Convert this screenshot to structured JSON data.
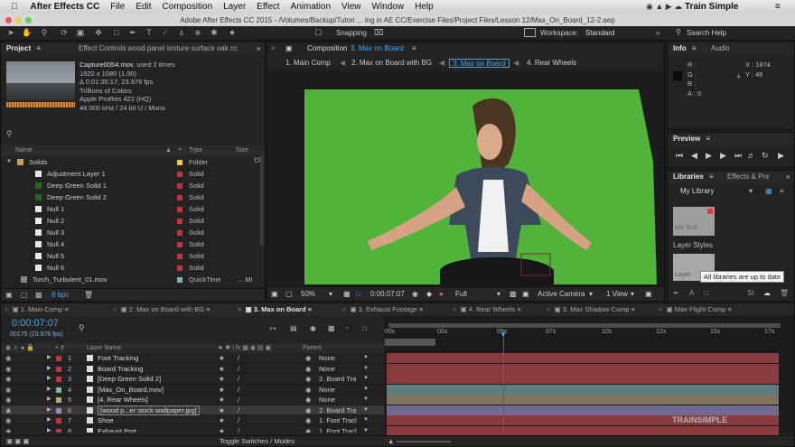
{
  "menubar": {
    "app": "After Effects CC",
    "items": [
      "File",
      "Edit",
      "Composition",
      "Layer",
      "Effect",
      "Animation",
      "View",
      "Window",
      "Help"
    ],
    "brand": "Train Simple"
  },
  "window_title": "Adobe After Effects CC 2015 - /Volumes/Backup/Tutori ... ing in AE CC/Exercise Files/Project Files/Lesson 12/Max_On_Board_12-2.aep",
  "toolbar": {
    "snapping": "Snapping",
    "workspace_label": "Workspace:",
    "workspace": "Standard",
    "search": "Search Help"
  },
  "project": {
    "tab": "Project",
    "effect_tab": "Effect Controls wood panel texture surface oak cc",
    "file_name": "Capture0054.mov",
    "used": ", used 2 times",
    "meta": [
      "1920 x 1080 (1.00)",
      "Δ 0:01:35:17, 23.976 fps",
      "Trillions of Colors",
      "Apple ProRes 422 (HQ)",
      "48.000 kHz / 24 bit U / Mono"
    ],
    "columns": {
      "name": "Name",
      "type": "Type",
      "size": "Size"
    },
    "items": [
      {
        "name": "Solids",
        "type": "Folder",
        "color": "#e6c84a",
        "icon": "folder-icon",
        "indent": 1
      },
      {
        "name": "Adjustment Layer 1",
        "type": "Solid",
        "color": "#c0363a",
        "icon": "white-solid-icon",
        "indent": 2
      },
      {
        "name": "Deep Green Solid 1",
        "type": "Solid",
        "color": "#c0363a",
        "icon": "green-solid-icon",
        "indent": 2
      },
      {
        "name": "Deep Green Solid 2",
        "type": "Solid",
        "color": "#c0363a",
        "icon": "green-solid-icon",
        "indent": 2
      },
      {
        "name": "Null 1",
        "type": "Solid",
        "color": "#c0363a",
        "icon": "white-solid-icon",
        "indent": 2
      },
      {
        "name": "Null 2",
        "type": "Solid",
        "color": "#c0363a",
        "icon": "white-solid-icon",
        "indent": 2
      },
      {
        "name": "Null 3",
        "type": "Solid",
        "color": "#c0363a",
        "icon": "white-solid-icon",
        "indent": 2
      },
      {
        "name": "Null 4",
        "type": "Solid",
        "color": "#c0363a",
        "icon": "white-solid-icon",
        "indent": 2
      },
      {
        "name": "Null 5",
        "type": "Solid",
        "color": "#c0363a",
        "icon": "white-solid-icon",
        "indent": 2
      },
      {
        "name": "Null 6",
        "type": "Solid",
        "color": "#c0363a",
        "icon": "white-solid-icon",
        "indent": 2
      },
      {
        "name": "Torch_Turbulent_01.mov",
        "type": "QuickTime",
        "size": "... MI",
        "color": "#7fb4b4",
        "icon": "footage-icon",
        "indent": 0
      }
    ],
    "bpc": "8 bpc"
  },
  "composition": {
    "tab_prefix": "Composition",
    "tab": "3. Max on Board",
    "breadcrumbs": [
      "1. Main Comp",
      "2. Max on Board with BG",
      "3. Max on Board",
      "4. Rear Wheels"
    ],
    "zoom": "50%",
    "timecode": "0:00:07:07",
    "resolution": "Full",
    "camera": "Active Camera",
    "view": "1 View"
  },
  "info": {
    "tab": "Info",
    "audio_tab": "Audio",
    "r": "R :",
    "g": "G :",
    "b": "B :",
    "a": "A : 0",
    "x": "X : 1874",
    "y": "Y : 46"
  },
  "preview": {
    "tab": "Preview"
  },
  "libraries": {
    "tab": "Libraries",
    "effects_tab": "Effects & Pre",
    "library": "My Library",
    "item1": "MV Bolt",
    "section": "Layer Styles",
    "item2": "Layer",
    "tooltip": "All libraries are up to date"
  },
  "timeline": {
    "tabs": [
      "1. Main Comp",
      "2. Max on Board with BG",
      "3. Max on Board",
      "3. Exhaust Footage",
      "4. Rear Wheels",
      "3. Max Shadow Comp",
      "Max Flight Comp"
    ],
    "active_tab": 2,
    "timecode": "0:00:07:07",
    "frames": "00175 (23.976 fps)",
    "col_layer": "Layer Name",
    "col_parent": "Parent",
    "ruler": [
      "00s",
      "05s",
      "10s",
      "15s",
      "17s"
    ],
    "ruler_mid": [
      "02s",
      "07s",
      "12s"
    ],
    "layers": [
      {
        "num": "1",
        "name": "Foot Tracking",
        "label": "#c0363a",
        "parent": "None",
        "bar": "#8a3b3d"
      },
      {
        "num": "2",
        "name": "Board Tracking",
        "label": "#c0363a",
        "parent": "None",
        "bar": "#8a3b3d"
      },
      {
        "num": "3",
        "name": "[Deep Green Solid 2]",
        "label": "#c0363a",
        "parent": "2. Board Tra",
        "bar": "#8a3b3d"
      },
      {
        "num": "4",
        "name": "[Max_On_Board.mov]",
        "label": "#7fb4b4",
        "parent": "None",
        "bar": "#5d7d7c"
      },
      {
        "num": "5",
        "name": "[4. Rear Wheels]",
        "label": "#b9a37a",
        "parent": "None",
        "bar": "#7f745e"
      },
      {
        "num": "6",
        "name": "[wood p...er stock wallpaper.jpg]",
        "label": "#9b8ac0",
        "parent": "2. Board Tra",
        "bar": "#74698e"
      },
      {
        "num": "7",
        "name": "Shoe",
        "label": "#c0363a",
        "parent": "1. Foot Tracl",
        "bar": "#8a3b3d"
      },
      {
        "num": "8",
        "name": "Exhaust Port",
        "label": "#c0363a",
        "parent": "1. Foot Tracl",
        "bar": "#8a3b3d"
      }
    ],
    "toggle": "Toggle Switches / Modes",
    "watermark": "TRAINSIMPLE"
  }
}
